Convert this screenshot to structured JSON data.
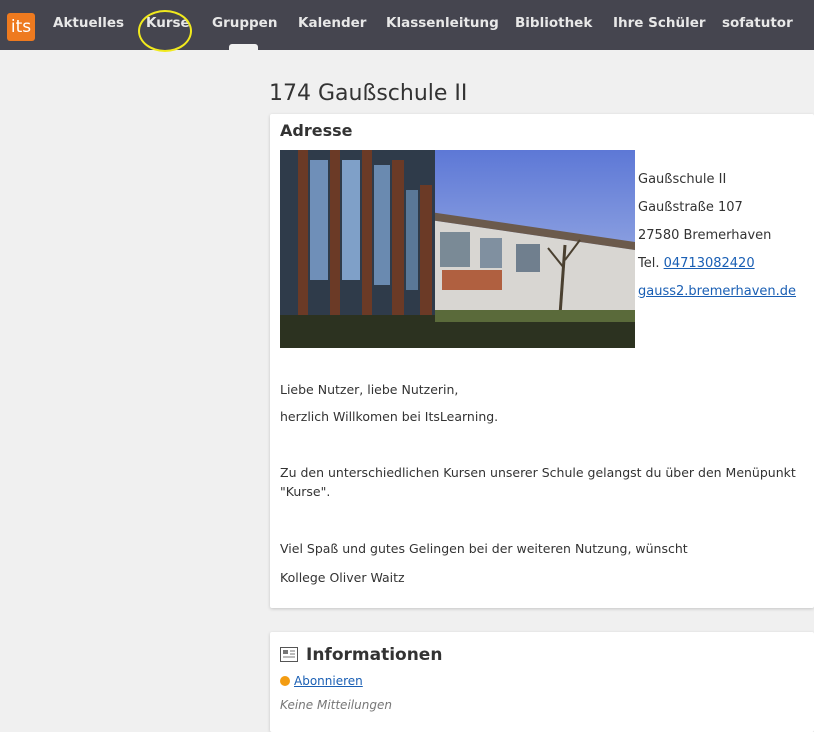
{
  "nav": {
    "logo": "its",
    "items": [
      "Aktuelles",
      "Kurse",
      "Gruppen",
      "Kalender",
      "Klassenleitung",
      "Bibliothek",
      "Ihre Schüler",
      "sofatutor"
    ]
  },
  "page": {
    "title": "174 Gaußschule II"
  },
  "address": {
    "heading": "Adresse",
    "school_name": "Gaußschule II",
    "street": "Gaußstraße 107",
    "city": "27580 Bremerhaven",
    "tel_prefix": "Tel. ",
    "tel_link": "04713082420",
    "website": "gauss2.bremerhaven.de"
  },
  "message": {
    "greeting": "Liebe Nutzer, liebe Nutzerin,",
    "welcome": "herzlich Willkomen bei ItsLearning.",
    "courses_line1": "Zu den unterschiedlichen Kursen unserer Schule gelangst du über den Menüpunkt",
    "courses_line2": "\"Kurse\".",
    "closing": "Viel Spaß und gutes Gelingen bei der weiteren Nutzung, wünscht",
    "signature": "Kollege Oliver Waitz"
  },
  "info": {
    "heading": "Informationen",
    "subscribe": "Abonnieren",
    "empty": "Keine Mitteilungen"
  },
  "colors": {
    "topbar": "#45454f",
    "logo": "#ee7a1f",
    "highlight": "#f0e91d",
    "link": "#1a5fb4"
  }
}
